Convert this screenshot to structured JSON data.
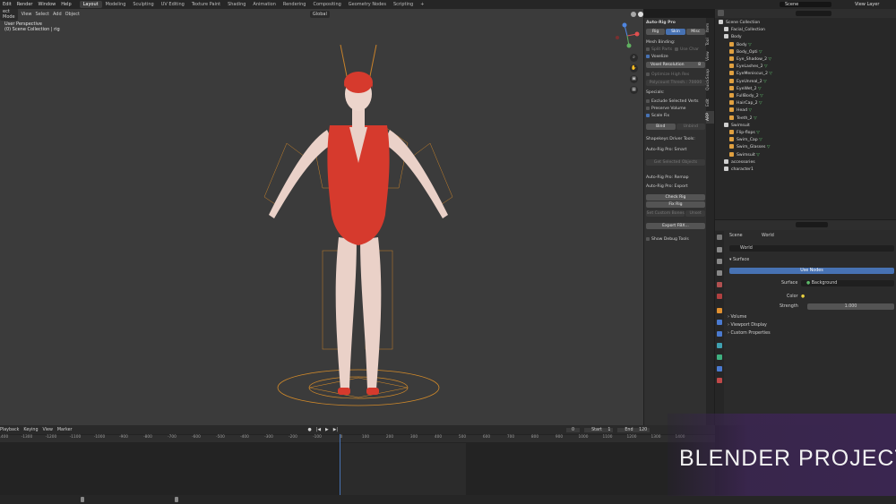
{
  "menu": {
    "items": [
      "Edit",
      "Render",
      "Window",
      "Help"
    ],
    "workspaces": [
      "Layout",
      "Modeling",
      "Sculpting",
      "UV Editing",
      "Texture Paint",
      "Shading",
      "Animation",
      "Rendering",
      "Compositing",
      "Geometry Nodes",
      "Scripting"
    ],
    "active_workspace": "Layout",
    "scene": "Scene",
    "view_layer": "View Layer"
  },
  "viewport": {
    "mode": "ect Mode",
    "menus": [
      "View",
      "Select",
      "Add",
      "Object"
    ],
    "orientation": "Global",
    "info_line1": "User Perspective",
    "info_line2": "(0) Scene Collection | rig"
  },
  "npanel": {
    "title": "Auto-Rig Pro",
    "tabs": [
      "Rig",
      "Skin",
      "Misc"
    ],
    "mesh_binding": "Mesh Binding:",
    "split_parts": "Split Parts",
    "use_char": "Use Char",
    "voxelize": "Voxelize",
    "voxel_resolution_label": "Voxel Resolution",
    "voxel_resolution_value": "8",
    "optimize_high_res": "Optimize High Res",
    "polycount": "Polycount Thresh.: 70000",
    "specials": "Specials:",
    "exclude_selected": "Exclude Selected Verts",
    "preserve_volume": "Preserve Volume",
    "scale_fix": "Scale Fix",
    "bind": "Bind",
    "unbind": "Unbind",
    "shapekeys": "Shapekeys Driver Tools:",
    "smart": "Auto-Rig Pro: Smart",
    "get_selected": "Get Selected Objects",
    "remap": "Auto-Rig Pro: Remap",
    "export": "Auto-Rig Pro: Export",
    "check_rig": "Check Rig",
    "fix_rig": "Fix Rig",
    "set_custom_bones": "Set Custom Bones",
    "unset": "Unset",
    "export_fbx": "Export FBX...",
    "show_debug": "Show Debug Tools",
    "side_tabs": [
      "Item",
      "Tool",
      "View",
      "QuickSnap",
      "Edit",
      "ARP"
    ]
  },
  "outliner": {
    "rows": [
      {
        "label": "Scene Collection",
        "indent": 0
      },
      {
        "label": "Facial_Collection",
        "indent": 1
      },
      {
        "label": "Body",
        "indent": 1
      },
      {
        "label": "Body",
        "indent": 2
      },
      {
        "label": "Body_Opti",
        "indent": 2
      },
      {
        "label": "Eye_Shadow_2",
        "indent": 2
      },
      {
        "label": "EyeLashes_2",
        "indent": 2
      },
      {
        "label": "EyeMeniscus_2",
        "indent": 2
      },
      {
        "label": "EyeUnreal_2",
        "indent": 2
      },
      {
        "label": "EyeWet_2",
        "indent": 2
      },
      {
        "label": "FullBody_2",
        "indent": 2
      },
      {
        "label": "HairCap_2",
        "indent": 2
      },
      {
        "label": "Head",
        "indent": 2
      },
      {
        "label": "Teeth_2",
        "indent": 2
      },
      {
        "label": "Swimsuit",
        "indent": 1
      },
      {
        "label": "Flip-flops",
        "indent": 2
      },
      {
        "label": "Swim_Cap",
        "indent": 2
      },
      {
        "label": "Swim_Glasses",
        "indent": 2
      },
      {
        "label": "Swimsuit",
        "indent": 2
      },
      {
        "label": "accessories",
        "indent": 1
      },
      {
        "label": "character1",
        "indent": 1
      }
    ]
  },
  "properties": {
    "tabs": [
      "Scene",
      "World"
    ],
    "world": "World",
    "surface_header": "Surface",
    "use_nodes": "Use Nodes",
    "surface_label": "Surface",
    "surface_value": "Background",
    "color_label": "Color",
    "strength_label": "Strength",
    "strength_value": "1.000",
    "volume": "Volume",
    "viewport_display": "Viewport Display",
    "custom_props": "Custom Properties"
  },
  "timeline": {
    "menus": [
      "Playback",
      "Keying",
      "View",
      "Marker"
    ],
    "current_frame": "0",
    "start_label": "Start",
    "start_value": "1",
    "end_label": "End",
    "end_value": "120",
    "ticks": [
      "-1400",
      "-1300",
      "-1200",
      "-1100",
      "-1000",
      "-900",
      "-800",
      "-700",
      "-600",
      "-500",
      "-400",
      "-300",
      "-200",
      "-100",
      "0",
      "100",
      "200",
      "300",
      "400",
      "500",
      "600",
      "700",
      "800",
      "900",
      "1000",
      "1100",
      "1200",
      "1300",
      "1400"
    ]
  },
  "banner": "BLENDER PROJECT",
  "colors": {
    "accent": "#4772b3",
    "orange": "#e0a040",
    "mesh_green": "#5dba6a"
  }
}
